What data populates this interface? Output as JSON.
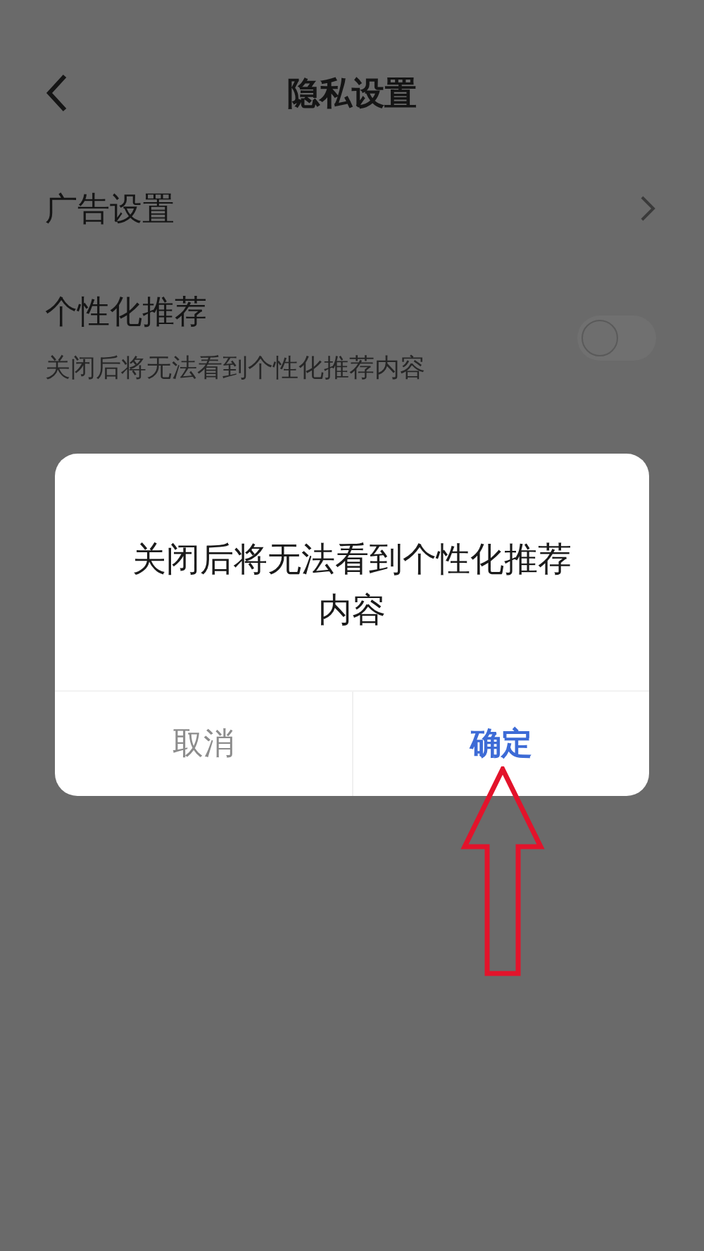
{
  "header": {
    "title": "隐私设置"
  },
  "settings": [
    {
      "kind": "link",
      "label": "广告设置"
    },
    {
      "kind": "switch",
      "label": "个性化推荐",
      "description": "关闭后将无法看到个性化推荐内容",
      "on": false
    }
  ],
  "dialog": {
    "message": "关闭后将无法看到个性化推荐内容",
    "buttons": [
      {
        "label": "取消",
        "kind": "cancel"
      },
      {
        "label": "确定",
        "kind": "confirm"
      }
    ]
  },
  "annotation": {
    "kind": "arrow"
  }
}
